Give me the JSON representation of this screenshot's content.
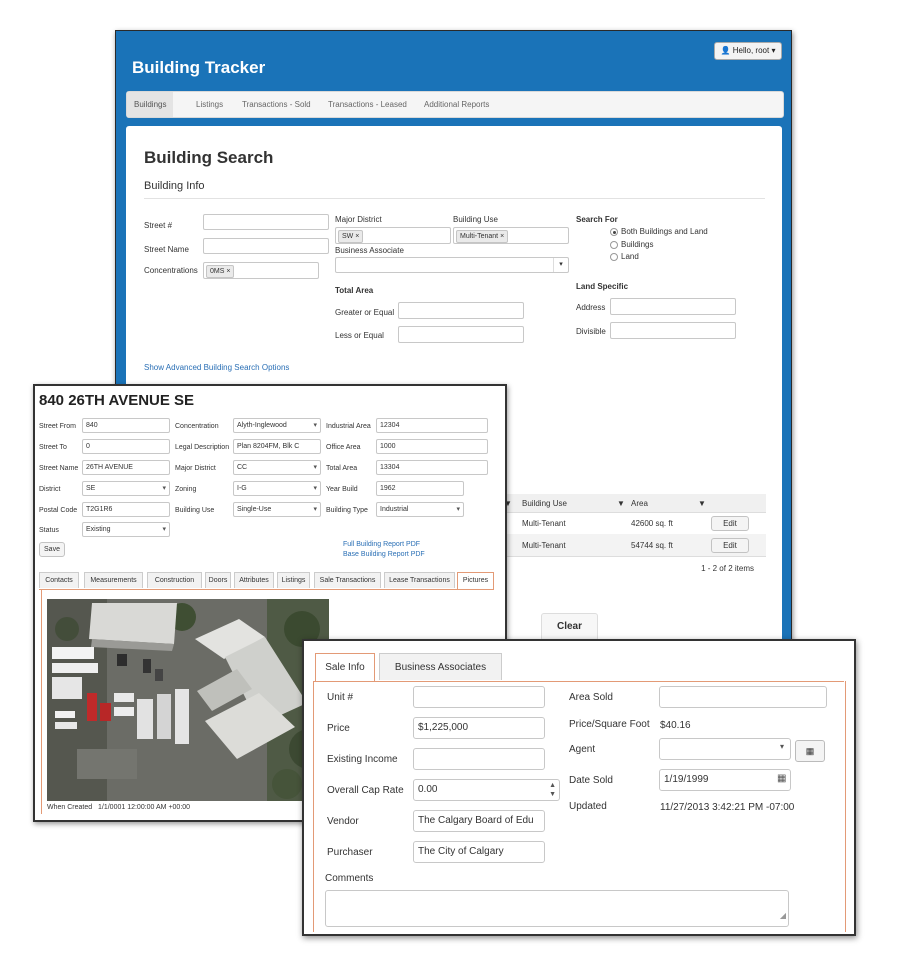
{
  "app": {
    "title": "Building Tracker",
    "user_menu": "Hello, root"
  },
  "nav": {
    "items": [
      {
        "label": "Buildings",
        "active": true
      },
      {
        "label": "Listings"
      },
      {
        "label": "Transactions - Sold"
      },
      {
        "label": "Transactions - Leased"
      },
      {
        "label": "Additional Reports"
      }
    ]
  },
  "search": {
    "page_title": "Building Search",
    "section_title": "Building Info",
    "street_no_label": "Street #",
    "street_name_label": "Street Name",
    "concentrations_label": "Concentrations",
    "concentrations_tag": "0MS ×",
    "major_district_label": "Major District",
    "major_district_tag": "SW ×",
    "building_use_label": "Building Use",
    "building_use_tag": "Multi-Tenant ×",
    "business_associate_label": "Business Associate",
    "total_area_label": "Total Area",
    "greater_label": "Greater or Equal",
    "less_label": "Less or Equal",
    "search_for_label": "Search For",
    "search_for_options": [
      "Both Buildings and Land",
      "Buildings",
      "Land"
    ],
    "land_specific_label": "Land Specific",
    "address_label": "Address",
    "divisible_label": "Divisible",
    "advanced_link": "Show Advanced Building Search Options",
    "clear_button": "Clear"
  },
  "results": {
    "headers": [
      "Building Use",
      "Area"
    ],
    "rows": [
      {
        "use": "Multi-Tenant",
        "area": "42600 sq. ft",
        "action": "Edit"
      },
      {
        "use": "Multi-Tenant",
        "area": "54744 sq. ft",
        "action": "Edit"
      }
    ],
    "pager": "1 - 2 of 2 items"
  },
  "detail": {
    "title": "840 26TH AVENUE SE",
    "street_from_label": "Street From",
    "street_from": "840",
    "street_to_label": "Street To",
    "street_to": "0",
    "street_name_label": "Street Name",
    "street_name": "26TH AVENUE",
    "district_label": "District",
    "district": "SE",
    "postal_label": "Postal Code",
    "postal": "T2G1R6",
    "status_label": "Status",
    "status": "Existing",
    "save": "Save",
    "concentration_label": "Concentration",
    "concentration": "Alyth-Inglewood",
    "legal_label": "Legal Description",
    "legal": "Plan 8204FM, Blk C",
    "major_district_label": "Major District",
    "major_district": "CC",
    "zoning_label": "Zoning",
    "zoning": "I-G",
    "building_use_label": "Building Use",
    "building_use": "Single-Use",
    "industrial_area_label": "Industrial Area",
    "industrial_area": "12304",
    "office_area_label": "Office Area",
    "office_area": "1000",
    "total_area_label": "Total Area",
    "total_area": "13304",
    "year_build_label": "Year Build",
    "year_build": "1962",
    "building_type_label": "Building Type",
    "building_type": "Industrial",
    "full_report_link": "Full Building Report PDF",
    "base_report_link": "Base Building Report PDF",
    "tabs": [
      "Contacts",
      "Measurements",
      "Construction",
      "Doors",
      "Attributes",
      "Listings",
      "Sale Transactions",
      "Lease Transactions",
      "Pictures"
    ],
    "active_tab": "Pictures",
    "when_created_label": "When Created",
    "when_created": "1/1/0001 12:00:00 AM +00:00"
  },
  "sale": {
    "tabs": [
      "Sale Info",
      "Business Associates"
    ],
    "unit_label": "Unit #",
    "unit": "",
    "price_label": "Price",
    "price": "$1,225,000",
    "existing_income_label": "Existing Income",
    "existing_income": "",
    "cap_rate_label": "Overall Cap Rate",
    "cap_rate": "0.00",
    "vendor_label": "Vendor",
    "vendor": "The Calgary Board of Edu",
    "purchaser_label": "Purchaser",
    "purchaser": "The City of Calgary",
    "comments_label": "Comments",
    "area_sold_label": "Area Sold",
    "area_sold": "",
    "price_sqft_label": "Price/Square Foot",
    "price_sqft": "$40.16",
    "agent_label": "Agent",
    "agent": "",
    "date_sold_label": "Date Sold",
    "date_sold": "1/19/1999",
    "updated_label": "Updated",
    "updated": "11/27/2013 3:42:21 PM -07:00"
  },
  "colors": {
    "brand_blue": "#1a73b8",
    "tab_accent": "#e39a76",
    "link": "#2a6fb5"
  }
}
